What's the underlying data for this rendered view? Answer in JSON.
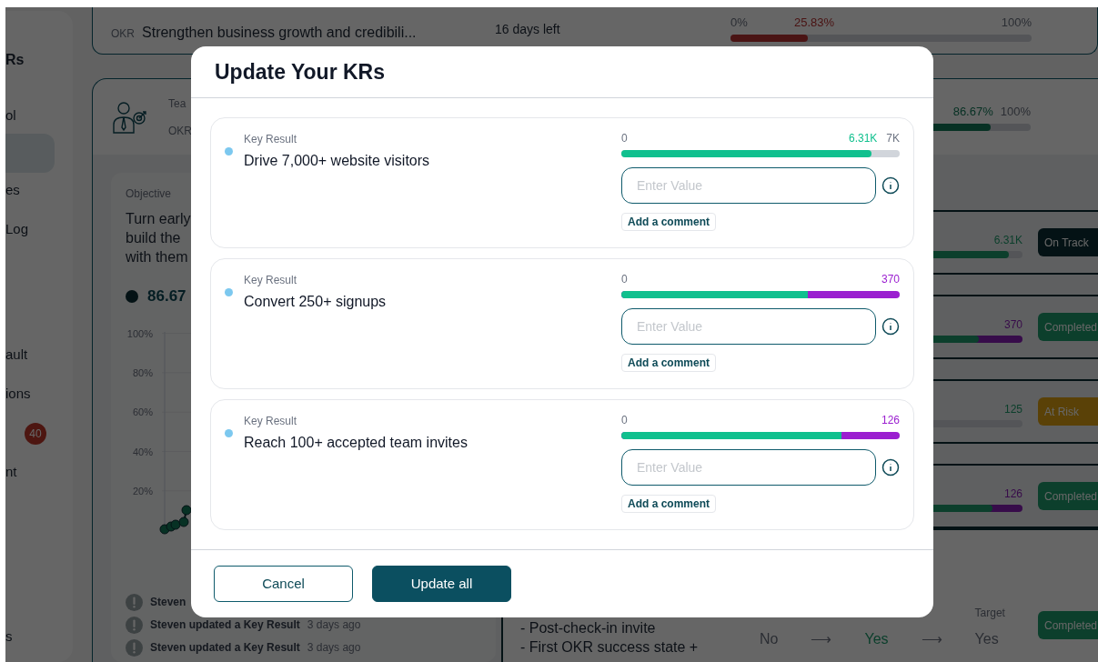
{
  "sidebar": {
    "heading": "Rs",
    "sections": [
      [
        {
          "label": "ol",
          "selected": false
        },
        {
          "selected": true
        },
        {
          "label": "es",
          "selected": false
        },
        {
          "label": "Log",
          "selected": false
        }
      ],
      [
        {
          "label": "ault",
          "selected": false
        },
        {
          "label": "ions",
          "selected": false
        },
        {
          "badge": "40",
          "selected": false
        },
        {
          "label": "nt",
          "selected": false
        }
      ],
      [
        {
          "label": "s",
          "selected": false
        }
      ]
    ]
  },
  "top_card": {
    "label": "OKR",
    "title": "Strengthen business growth and credibili...",
    "time_left": "16 days left",
    "progress": {
      "start": "0%",
      "current": "25.83%",
      "end": "100%",
      "level": 0.2583,
      "kind": "behind"
    }
  },
  "team_card": {
    "line_1": "Tea",
    "line_2": "OKR",
    "progress": {
      "current": "86.67%",
      "end": "100%",
      "level": 0.8667,
      "kind": "ahead"
    }
  },
  "objective": {
    "heading": "Objective",
    "lines": [
      "Turn early",
      "build the",
      "with them"
    ],
    "progress": "86.67",
    "chart_ticks": [
      "100%",
      "80%",
      "60%",
      "40%",
      "20%"
    ],
    "activity": [
      {
        "text": "Steven"
      },
      {
        "text": "Steven updated a Key Result",
        "time": "3 days ago"
      },
      {
        "text": "Steven updated a Key Result",
        "time": "3 days ago"
      }
    ]
  },
  "kr_rows": [
    {
      "value": "6.31K",
      "level": 0.95,
      "overflow": false,
      "status": "On Track",
      "kind": "on_track"
    },
    {
      "value": "370",
      "level": 0.84,
      "overflow": true,
      "status": "Completed",
      "kind": "completed"
    },
    {
      "value": "125",
      "overflow": false,
      "status": "At Risk",
      "kind": "at_risk"
    },
    {
      "value": "126",
      "level": 0.89,
      "overflow": true,
      "status": "Completed",
      "kind": "completed"
    }
  ],
  "bottom_row": {
    "lines": [
      "- Post-check-in invite",
      "- First OKR success state +"
    ],
    "start": "No",
    "arrows": [
      "⟶",
      "⟶"
    ],
    "current": "Yes",
    "target_label": "Target",
    "target": "Yes",
    "status": "Completed",
    "kind": "completed"
  },
  "modal": {
    "title": "Update Your KRs",
    "key_results": [
      {
        "label": "Key Result",
        "title": "Drive 7,000+ website visitors",
        "start": "0",
        "current": "6.31K",
        "target": "7K",
        "level": 0.9,
        "overflow": false,
        "placeholder": "Enter Value",
        "comment_button": "Add a comment"
      },
      {
        "label": "Key Result",
        "title": "Convert 250+ signups",
        "start": "0",
        "current": "370",
        "level": 0.67,
        "overflow": true,
        "placeholder": "Enter Value",
        "comment_button": "Add a comment"
      },
      {
        "label": "Key Result",
        "title": "Reach 100+ accepted team invites",
        "start": "0",
        "current": "126",
        "level": 0.79,
        "overflow": true,
        "placeholder": "Enter Value",
        "comment_button": "Add a comment"
      }
    ],
    "buttons": [
      {
        "label": "Cancel",
        "kind": "secondary"
      },
      {
        "label": "Update all",
        "kind": "primary"
      }
    ]
  }
}
